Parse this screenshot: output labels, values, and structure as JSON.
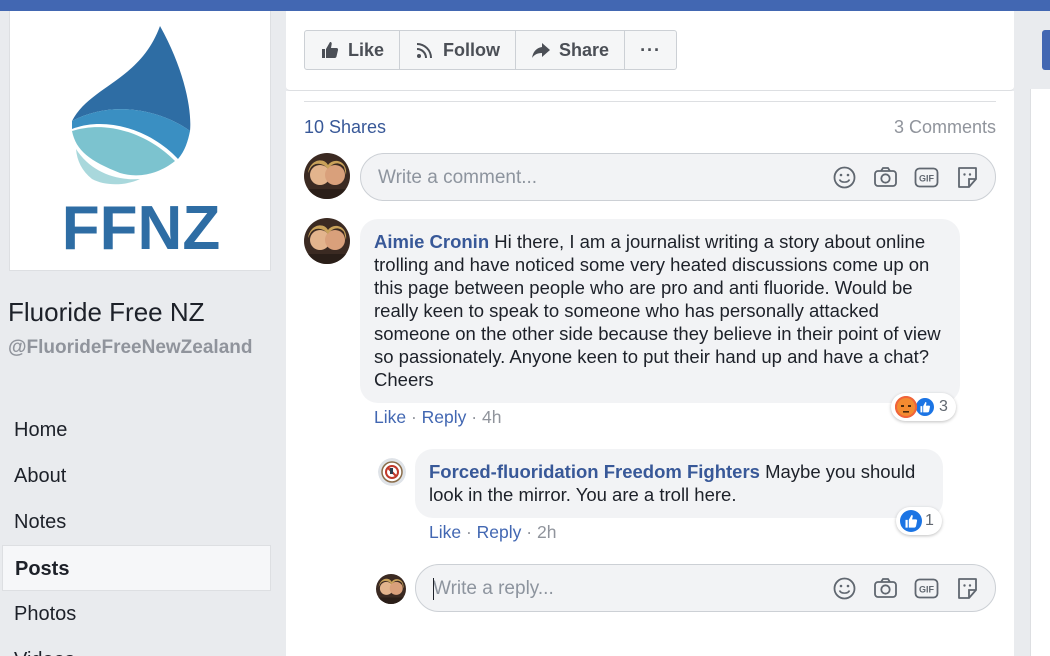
{
  "page": {
    "name": "Fluoride Free NZ",
    "handle": "@FluorideFreeNewZealand",
    "logo_text": "FFNZ"
  },
  "nav": {
    "items": [
      {
        "label": "Home"
      },
      {
        "label": "About"
      },
      {
        "label": "Notes"
      },
      {
        "label": "Posts"
      },
      {
        "label": "Photos"
      },
      {
        "label": "Videos"
      }
    ],
    "active": "Posts"
  },
  "actions": {
    "like": "Like",
    "follow": "Follow",
    "share": "Share",
    "more": "···"
  },
  "post": {
    "shares": "10 Shares",
    "comments_count": "3 Comments",
    "comment_placeholder": "Write a comment...",
    "reply_placeholder": "Write a reply..."
  },
  "comments": [
    {
      "author": "Aimie Cronin",
      "text": "Hi there, I am a journalist writing a story about online trolling and have noticed some very heated discussions come up on this page between people who are pro and anti fluoride. Would be really keen to speak to someone who has personally attacked someone on the other side because they believe in their point of view so passionately. Anyone keen to put their hand up and have a chat? Cheers",
      "like": "Like",
      "reply": "Reply",
      "time": "4h",
      "reaction_count": "3",
      "reactions": [
        "angry-icon",
        "like-icon"
      ]
    },
    {
      "author": "Forced-fluoridation Freedom Fighters",
      "text": "Maybe you should look in the mirror. You are a troll here.",
      "like": "Like",
      "reply": "Reply",
      "time": "2h",
      "reaction_count": "1",
      "reactions": [
        "like-icon"
      ]
    }
  ],
  "colors": {
    "brand_blue": "#4267b2",
    "link_blue": "#385898",
    "logo_blue": "#2e6da4"
  },
  "icons": [
    "thumbs-up-icon",
    "rss-icon",
    "share-arrow-icon",
    "smiley-icon",
    "camera-icon",
    "gif-icon",
    "sticker-icon"
  ]
}
